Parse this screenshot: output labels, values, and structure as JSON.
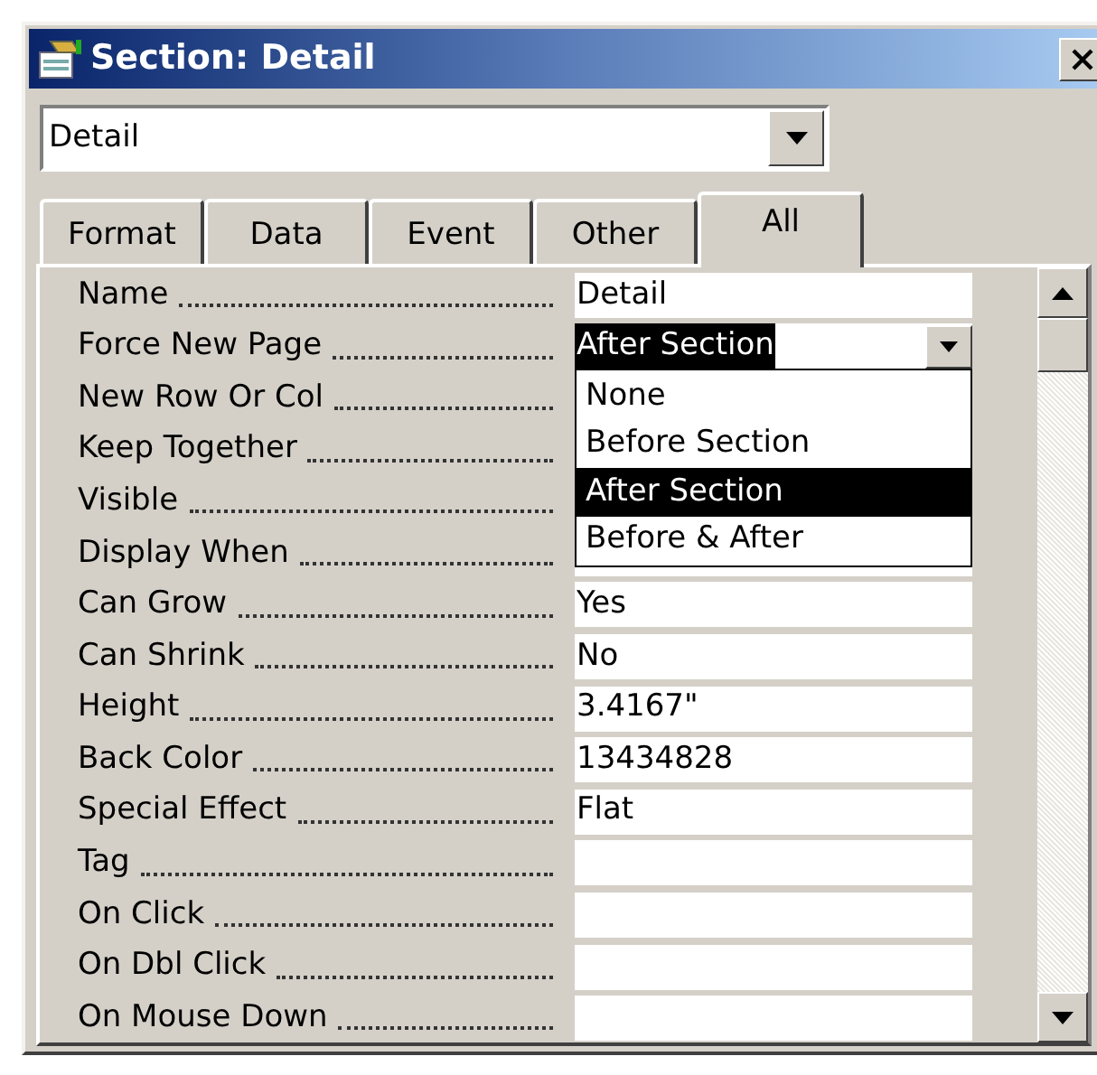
{
  "window": {
    "title": "Section: Detail"
  },
  "object_selector": {
    "value": "Detail"
  },
  "tabs": [
    {
      "label": "Format",
      "selected": false
    },
    {
      "label": "Data",
      "selected": false
    },
    {
      "label": "Event",
      "selected": false
    },
    {
      "label": "Other",
      "selected": false
    },
    {
      "label": "All",
      "selected": true
    }
  ],
  "properties": [
    {
      "label": "Name",
      "value": "Detail"
    },
    {
      "label": "Force New Page",
      "value": "After Section",
      "kind": "dropdown",
      "expanded": true,
      "options": [
        {
          "label": "None",
          "selected": false
        },
        {
          "label": "Before Section",
          "selected": false
        },
        {
          "label": "After Section",
          "selected": true
        },
        {
          "label": "Before & After",
          "selected": false
        }
      ]
    },
    {
      "label": "New Row Or Col"
    },
    {
      "label": "Keep Together"
    },
    {
      "label": "Visible"
    },
    {
      "label": "Display When"
    },
    {
      "label": "Can Grow",
      "value": "Yes"
    },
    {
      "label": "Can Shrink",
      "value": "No"
    },
    {
      "label": "Height",
      "value": "3.4167\""
    },
    {
      "label": "Back Color",
      "value": "13434828"
    },
    {
      "label": "Special Effect",
      "value": "Flat"
    },
    {
      "label": "Tag"
    },
    {
      "label": "On Click"
    },
    {
      "label": "On Dbl Click"
    },
    {
      "label": "On Mouse Down"
    }
  ]
}
